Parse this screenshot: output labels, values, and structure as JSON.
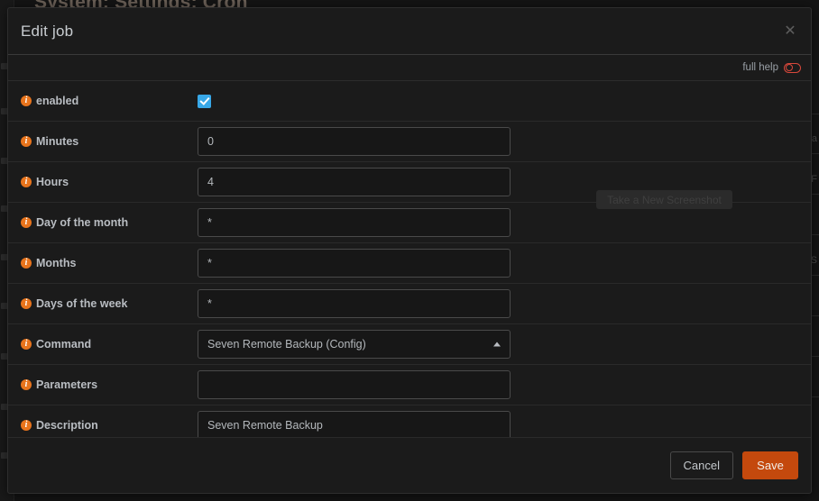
{
  "background": {
    "heading": "System: Settings: Cron",
    "right_labels": [
      "la",
      "F",
      "S"
    ]
  },
  "modal": {
    "title": "Edit job",
    "close_icon": "close-icon",
    "close_glyph": "✕",
    "help": {
      "label": "full help",
      "toggle_state": "off",
      "toggle_color": "#d9483b"
    },
    "fields": [
      {
        "label": "enabled",
        "type": "checkbox",
        "checked": true,
        "info_glyph": "i"
      },
      {
        "label": "Minutes",
        "type": "text",
        "value": "0",
        "placeholder": "",
        "info_glyph": "i"
      },
      {
        "label": "Hours",
        "type": "text",
        "value": "4",
        "placeholder": "",
        "info_glyph": "i"
      },
      {
        "label": "Day of the month",
        "type": "text",
        "value": "*",
        "placeholder": "",
        "info_glyph": "i"
      },
      {
        "label": "Months",
        "type": "text",
        "value": "*",
        "placeholder": "",
        "info_glyph": "i"
      },
      {
        "label": "Days of the week",
        "type": "text",
        "value": "*",
        "placeholder": "",
        "info_glyph": "i"
      },
      {
        "label": "Command",
        "type": "select",
        "value": "Seven Remote Backup (Config)",
        "info_glyph": "i"
      },
      {
        "label": "Parameters",
        "type": "text",
        "value": "",
        "placeholder": "",
        "info_glyph": "i"
      },
      {
        "label": "Description",
        "type": "text",
        "value": "Seven Remote Backup",
        "placeholder": "",
        "info_glyph": "i"
      }
    ],
    "footer": {
      "cancel_label": "Cancel",
      "save_label": "Save",
      "save_color": "#c4490d"
    }
  },
  "overlay": {
    "screenshot_tooltip": "Take a New Screenshot"
  },
  "colors": {
    "accent_orange": "#e8741c",
    "checkbox_blue": "#38a8e8",
    "modal_bg": "#1b1b1b",
    "page_bg": "#141414"
  }
}
